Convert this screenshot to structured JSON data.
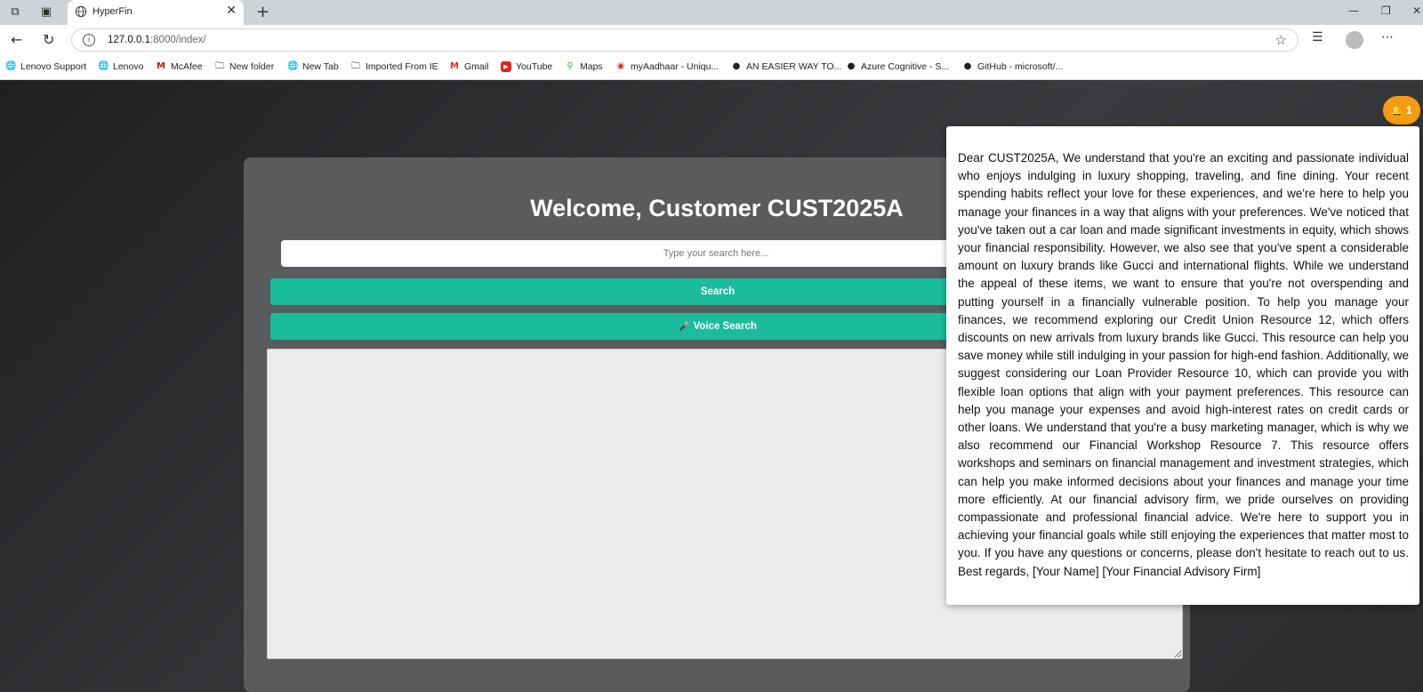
{
  "browser": {
    "tab_title": "HyperFin",
    "url_host": "127.0.0.1",
    "url_path": ":8000/index/",
    "bookmarks": [
      {
        "label": "Lenovo Support",
        "icon": "globe-icon"
      },
      {
        "label": "Lenovo",
        "icon": "globe-icon"
      },
      {
        "label": "McAfee",
        "icon": "mcafee-icon"
      },
      {
        "label": "New folder",
        "icon": "folder-icon"
      },
      {
        "label": "New Tab",
        "icon": "globe-icon"
      },
      {
        "label": "Imported From IE",
        "icon": "folder-icon"
      },
      {
        "label": "Gmail",
        "icon": "gmail-icon"
      },
      {
        "label": "YouTube",
        "icon": "youtube-icon"
      },
      {
        "label": "Maps",
        "icon": "maps-icon"
      },
      {
        "label": "myAadhaar - Uniqu...",
        "icon": "aadhaar-icon"
      },
      {
        "label": "AN EASIER WAY TO...",
        "icon": "github-icon"
      },
      {
        "label": "Azure Cognitive - S...",
        "icon": "github-icon"
      },
      {
        "label": "GitHub - microsoft/...",
        "icon": "github-icon"
      }
    ]
  },
  "main": {
    "welcome": "Welcome, Customer CUST2025A",
    "search_placeholder": "Type your search here...",
    "search_button": "Search",
    "voice_button": "Voice Search",
    "voice_icon": "🎤"
  },
  "notification": {
    "count": "1",
    "message": "Dear CUST2025A, We understand that you're an exciting and passionate individual who enjoys indulging in luxury shopping, traveling, and fine dining. Your recent spending habits reflect your love for these experiences, and we're here to help you manage your finances in a way that aligns with your preferences. We've noticed that you've taken out a car loan and made significant investments in equity, which shows your financial responsibility. However, we also see that you've spent a considerable amount on luxury brands like Gucci and international flights. While we understand the appeal of these items, we want to ensure that you're not overspending and putting yourself in a financially vulnerable position. To help you manage your finances, we recommend exploring our Credit Union Resource 12, which offers discounts on new arrivals from luxury brands like Gucci. This resource can help you save money while still indulging in your passion for high-end fashion. Additionally, we suggest considering our Loan Provider Resource 10, which can provide you with flexible loan options that align with your payment preferences. This resource can help you manage your expenses and avoid high-interest rates on credit cards or other loans. We understand that you're a busy marketing manager, which is why we also recommend our Financial Workshop Resource 7. This resource offers workshops and seminars on financial management and investment strategies, which can help you make informed decisions about your finances and manage your time more efficiently. At our financial advisory firm, we pride ourselves on providing compassionate and professional financial advice. We're here to support you in achieving your financial goals while still enjoying the experiences that matter most to you. If you have any questions or concerns, please don't hesitate to reach out to us. Best regards, [Your Name] [Your Financial Advisory Firm]"
  },
  "colors": {
    "accent": "#1abc9c",
    "badge": "#f39c12",
    "card": "#5a5b5d"
  }
}
